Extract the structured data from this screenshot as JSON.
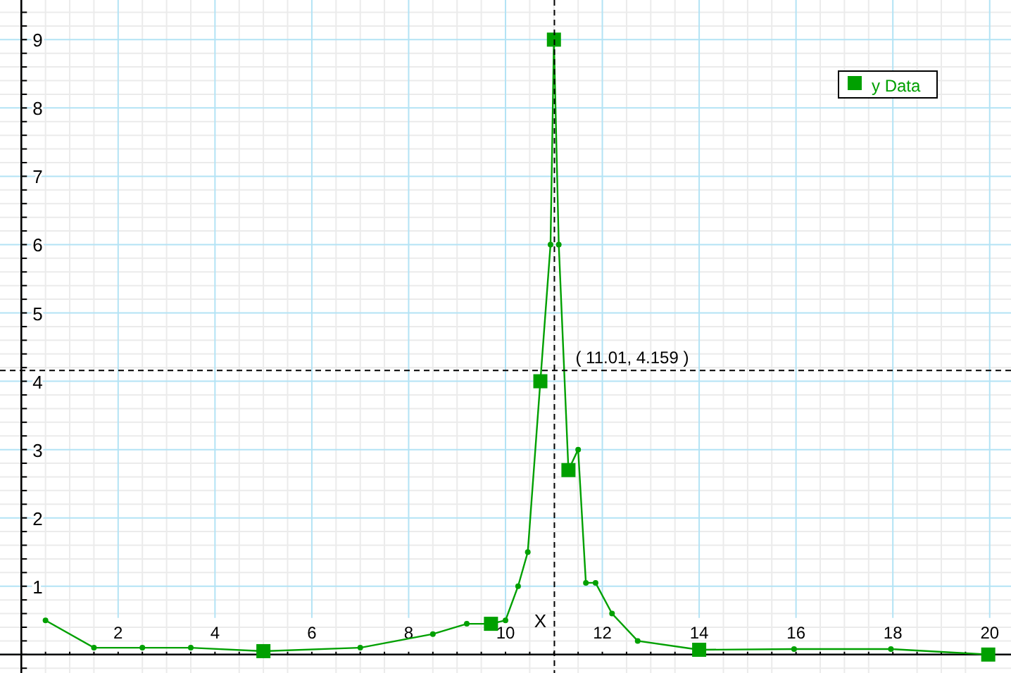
{
  "plot": {
    "chart_data": {
      "type": "line",
      "xlabel": "X",
      "xlim": [
        -0.44,
        20.44
      ],
      "ylim": [
        -0.27,
        9.58
      ],
      "grid": true,
      "xticks": [
        2,
        4,
        6,
        8,
        10,
        12,
        14,
        16,
        18,
        20
      ],
      "yticks": [
        1,
        2,
        3,
        4,
        5,
        6,
        7,
        8,
        9
      ],
      "x": [
        0.5,
        1.5,
        2.5,
        3.5,
        5,
        7,
        8.5,
        9.2,
        9.7,
        10,
        10.26,
        10.46,
        10.72,
        10.93,
        11,
        11.1,
        11.3,
        11.5,
        11.66,
        11.86,
        12.2,
        12.73,
        14,
        15.96,
        17.96,
        19.97
      ],
      "series": [
        {
          "name": "y Data",
          "color": "#00a000",
          "values": [
            0.5,
            0.1,
            0.1,
            0.1,
            0.05,
            0.1,
            0.3,
            0.45,
            0.45,
            0.5,
            1,
            1.5,
            4,
            6,
            9,
            6,
            2.7,
            3,
            1.05,
            1.05,
            0.6,
            0.2,
            0.07,
            0.08,
            0.08,
            0
          ],
          "marker": [
            "circle",
            "circle",
            "circle",
            "circle",
            "square",
            "circle",
            "circle",
            "circle",
            "square",
            "circle",
            "circle",
            "circle",
            "square",
            "circle",
            "square",
            "circle",
            "square",
            "circle",
            "circle",
            "circle",
            "circle",
            "circle",
            "square",
            "circle",
            "circle",
            "square"
          ]
        }
      ],
      "ref_lines": [
        {
          "axis": "x",
          "value": 11.01
        },
        {
          "axis": "y",
          "value": 4.159
        }
      ],
      "annotations": [
        {
          "x": 11.01,
          "y": 4.159,
          "text": "( 11.01, 4.159 )"
        }
      ]
    }
  }
}
